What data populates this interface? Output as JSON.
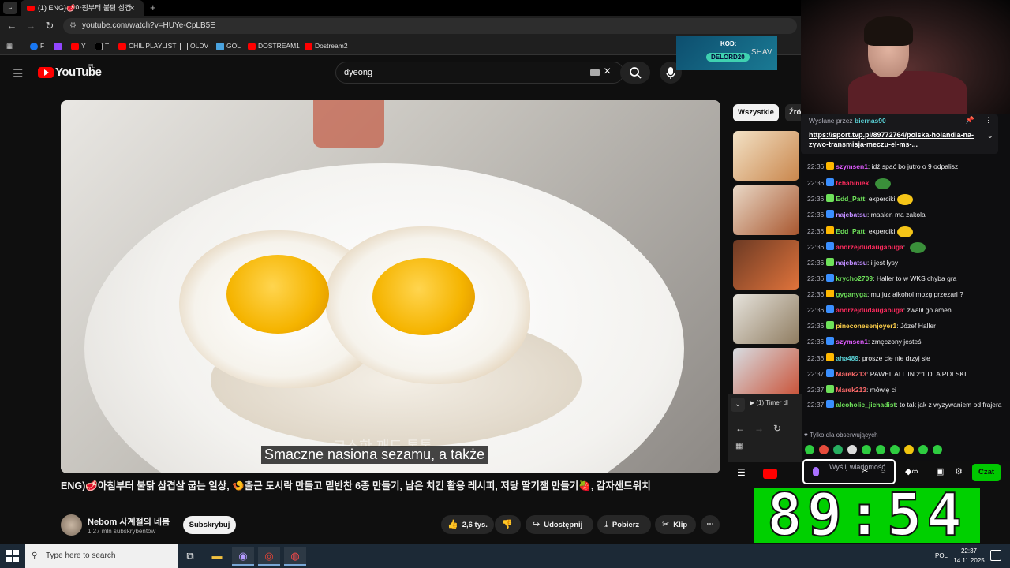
{
  "browser": {
    "tab_title": "(1) ENG)🥩아침부터 불닭 삼겹",
    "url": "youtube.com/watch?v=HUYe-CpLB5E",
    "bookmarks": [
      "F",
      "Y",
      "T",
      "CHIL PLAYLIST",
      "OLDV",
      "GOL",
      "DOSTREAM1",
      "Dostream2"
    ]
  },
  "youtube": {
    "logo_text": "YouTube",
    "region": "PL",
    "search_value": "dyeong",
    "subtitle_ghost": "고소한 깨도 톡톡",
    "subtitle": "Smaczne nasiona sezamu, a także",
    "video_title": "ENG)🥩아침부터 불닭 삼겹살 굽는 일상, 🍤출근 도시락 만들고 밑반찬 6종 만들기, 남은 치킨 활용 레시피, 저당 딸기잼 만들기🍓, 감자샌드위치",
    "channel_name": "Nebom 사계절의 네봄",
    "subscribers": "1,27 mln subskrybentów",
    "subscribe_label": "Subskrybuj",
    "likes": "2,6 tys.",
    "share_label": "Udostępnij",
    "download_label": "Pobierz",
    "clip_label": "Klip",
    "chip_all": "Wszystkie",
    "chip_second": "Źró"
  },
  "sponsor": {
    "kod_label": "KOD:",
    "code": "DELORD20",
    "brand": "SHAV"
  },
  "chat": {
    "pinned_by_label": "Wysłane przez",
    "pinned_by_user": "biernas90",
    "pinned_link": "https://sport.tvp.pl/89772764/polska-holandia-na-zywo-transmisja-meczu-el-ms-...",
    "messages": [
      {
        "time": "22:36",
        "user": "szymsen1",
        "text": "idź spać bo jutro o 9 odpalisz",
        "color": "#e05cff"
      },
      {
        "time": "22:36",
        "user": "tchabiniek",
        "text": "",
        "color": "#ff2b5e"
      },
      {
        "time": "22:36",
        "user": "Edd_Patt",
        "text": "experciki",
        "color": "#6ee15a"
      },
      {
        "time": "22:36",
        "user": "najebatsu",
        "text": "maalen ma zakola",
        "color": "#c08cff"
      },
      {
        "time": "22:36",
        "user": "Edd_Patt",
        "text": "experciki",
        "color": "#6ee15a"
      },
      {
        "time": "22:36",
        "user": "andrzejdudaugabuga",
        "text": "",
        "color": "#ff2b5e"
      },
      {
        "time": "22:36",
        "user": "najebatsu",
        "text": "i jest łysy",
        "color": "#c08cff"
      },
      {
        "time": "22:36",
        "user": "krycho2709",
        "text": "Haller to w WKS chyba gra",
        "color": "#6ee15a"
      },
      {
        "time": "22:36",
        "user": "gyganyga",
        "text": "mu juz alkohol mozg przezarl ?",
        "color": "#6ee15a"
      },
      {
        "time": "22:36",
        "user": "andrzejdudaugabuga",
        "text": "zwalił go amen",
        "color": "#ff2b5e"
      },
      {
        "time": "22:36",
        "user": "pineconesenjoyer1",
        "text": "Józef Haller",
        "color": "#ffd04a"
      },
      {
        "time": "22:36",
        "user": "szymsen1",
        "text": "zmęczony jesteś",
        "color": "#e05cff"
      },
      {
        "time": "22:36",
        "user": "aha489",
        "text": "prosze cie nie drzyj sie",
        "color": "#5ad1d6"
      },
      {
        "time": "22:37",
        "user": "Marek213",
        "text": "PAWEL ALL IN 2:1 DLA POLSKI",
        "color": "#ff6b6b"
      },
      {
        "time": "22:37",
        "user": "Marek213",
        "text": "mówię ci",
        "color": "#ff6b6b"
      },
      {
        "time": "22:37",
        "user": "alcoholic_jichadist",
        "text": "to tak jak z wyzywaniem od frajera",
        "color": "#6ee15a"
      }
    ],
    "followers_only": "Tylko dla obserwujących",
    "input_placeholder": "Wyślij wiadomość",
    "send_label": "Czat"
  },
  "timer": {
    "value": "89:54"
  },
  "taskbar": {
    "search_placeholder": "Type here to search",
    "language": "POL",
    "time": "22:37",
    "date": "14.11.2025"
  }
}
